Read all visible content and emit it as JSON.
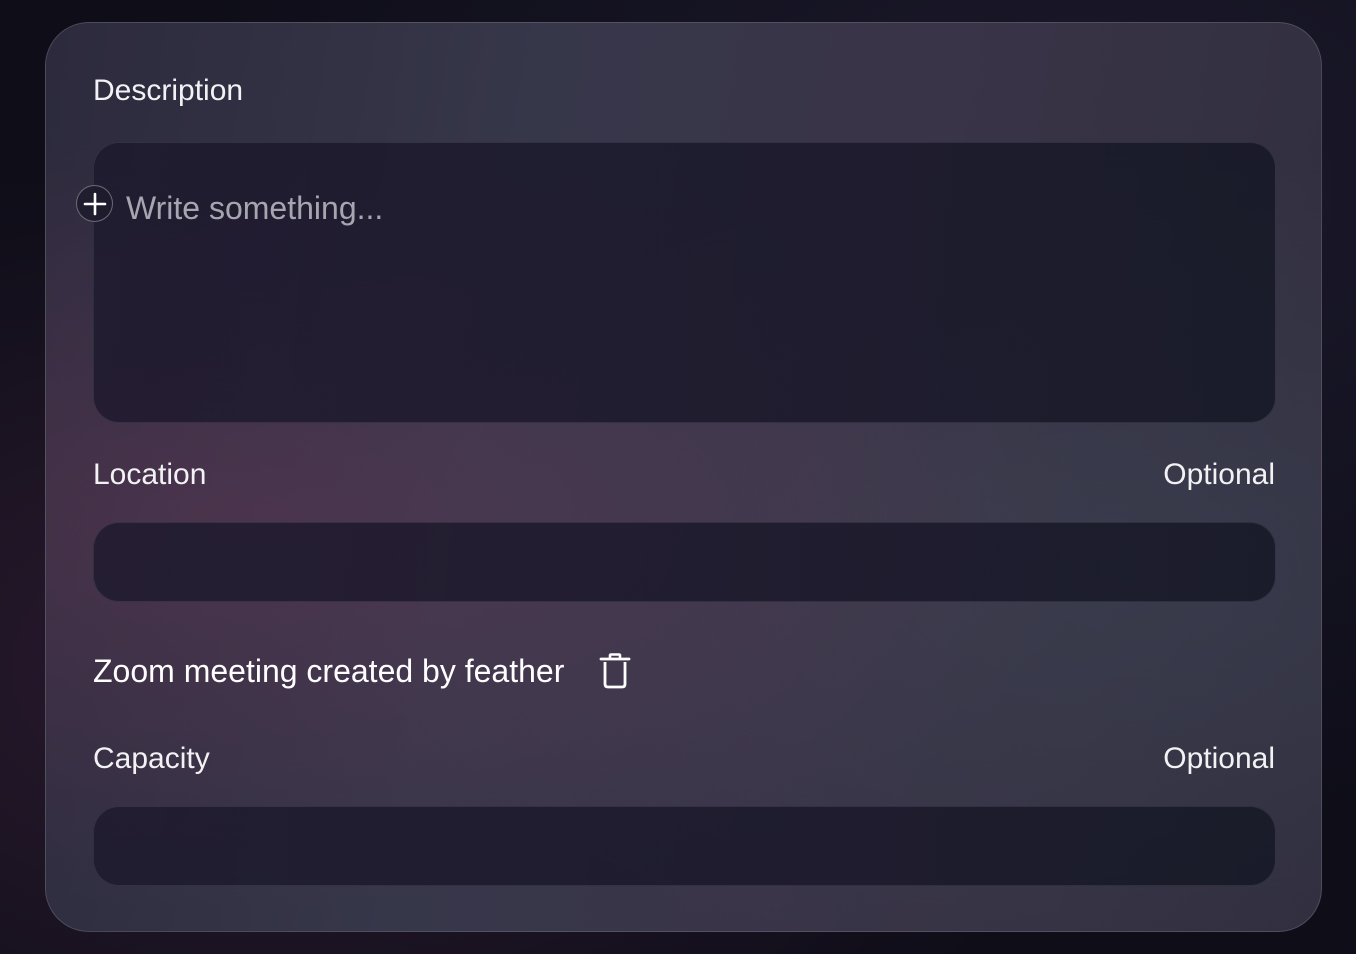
{
  "form": {
    "description": {
      "label": "Description",
      "placeholder": "Write something..."
    },
    "location": {
      "label": "Location",
      "optional_label": "Optional",
      "value": ""
    },
    "zoom": {
      "text": "Zoom meeting created by feather"
    },
    "capacity": {
      "label": "Capacity",
      "optional_label": "Optional",
      "value": ""
    }
  },
  "icons": {
    "add": "plus-icon",
    "delete": "trash-icon"
  }
}
